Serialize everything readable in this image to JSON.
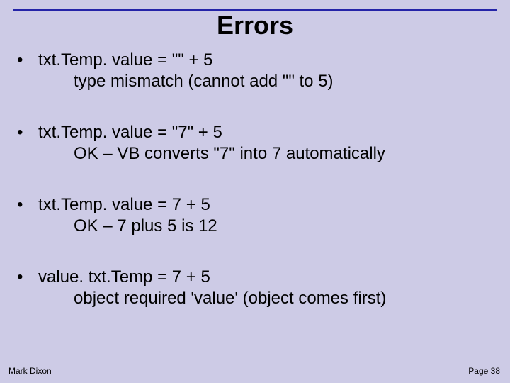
{
  "title": "Errors",
  "bullets": [
    {
      "code": "txt.Temp. value = \"\" + 5",
      "note": "type mismatch (cannot add \"\" to 5)"
    },
    {
      "code": "txt.Temp. value = \"7\" + 5",
      "note": "OK – VB converts \"7\" into 7 automatically"
    },
    {
      "code": "txt.Temp. value = 7 + 5",
      "note": "OK – 7 plus 5 is 12"
    },
    {
      "code": "value. txt.Temp = 7 + 5",
      "note": "object required 'value' (object comes first)"
    }
  ],
  "footer": {
    "author": "Mark Dixon",
    "page": "Page 38"
  },
  "glyphs": {
    "bullet": "•"
  }
}
